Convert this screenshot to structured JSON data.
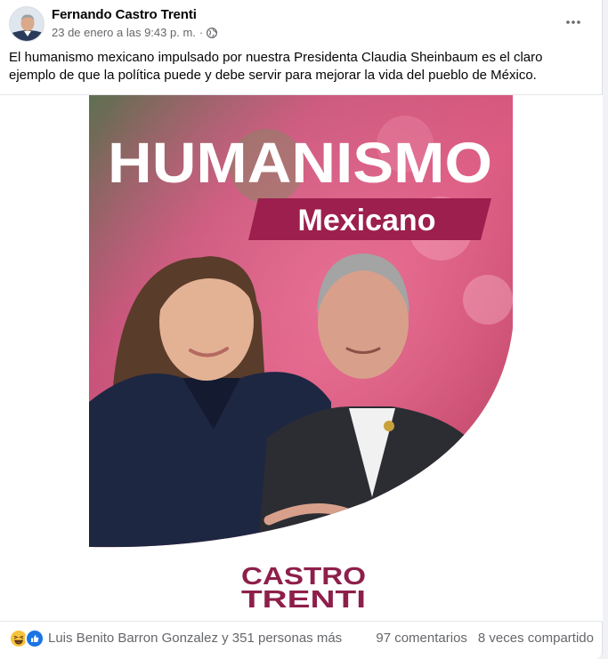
{
  "post": {
    "author": "Fernando Castro Trenti",
    "timestamp": "23 de enero a las 9:43 p. m.",
    "separator": "·",
    "privacy_icon": "globe-icon",
    "more_icon": "more-options-icon",
    "caption": "El humanismo mexicano impulsado por nuestra Presidenta Claudia Sheinbaum es el claro ejemplo de que la política puede y debe servir para mejorar la vida del pueblo de México."
  },
  "image": {
    "headline": "HUMANISMO",
    "subheadline": "Mexicano",
    "logo_line1": "CASTRO",
    "logo_line2": "TRENTI",
    "colors": {
      "brand": "#8e1f4a",
      "banner": "#9c1f4d",
      "headline": "#ffffff"
    }
  },
  "footer": {
    "reaction_icons": [
      "haha-icon",
      "like-icon"
    ],
    "reactions_text": "Luis Benito Barron Gonzalez y 351 personas más",
    "comments": "97 comentarios",
    "shares": "8 veces compartido"
  }
}
